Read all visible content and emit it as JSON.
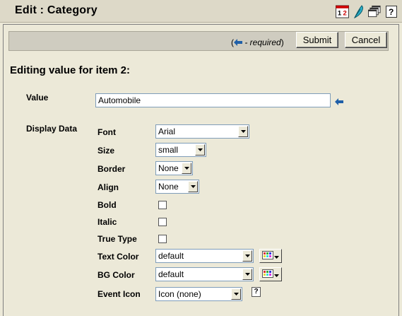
{
  "window": {
    "title": "Edit : Category",
    "icons": [
      "calendar-12-icon",
      "feather-icon",
      "copy-windows-icon",
      "help-icon"
    ]
  },
  "toolbar": {
    "required_note": "- required",
    "paren_open": "(",
    "paren_close": ")",
    "submit_label": "Submit",
    "cancel_label": "Cancel"
  },
  "form": {
    "heading": "Editing value for item 2:",
    "value_label": "Value",
    "value": "Automobile",
    "display_data_label": "Display Data",
    "fields": {
      "font": {
        "label": "Font",
        "value": "Arial"
      },
      "size": {
        "label": "Size",
        "value": "small"
      },
      "border": {
        "label": "Border",
        "value": "None"
      },
      "align": {
        "label": "Align",
        "value": "None"
      },
      "bold": {
        "label": "Bold",
        "checked": false
      },
      "italic": {
        "label": "Italic",
        "checked": false
      },
      "true_type": {
        "label": "True Type",
        "checked": false
      },
      "text_color": {
        "label": "Text Color",
        "value": "default"
      },
      "bg_color": {
        "label": "BG Color",
        "value": "default"
      },
      "event_icon": {
        "label": "Event Icon",
        "value": "Icon (none)"
      }
    }
  },
  "colors": {
    "accent_arrow": "#1f5fa8",
    "panel_bg": "#ece9d8"
  }
}
